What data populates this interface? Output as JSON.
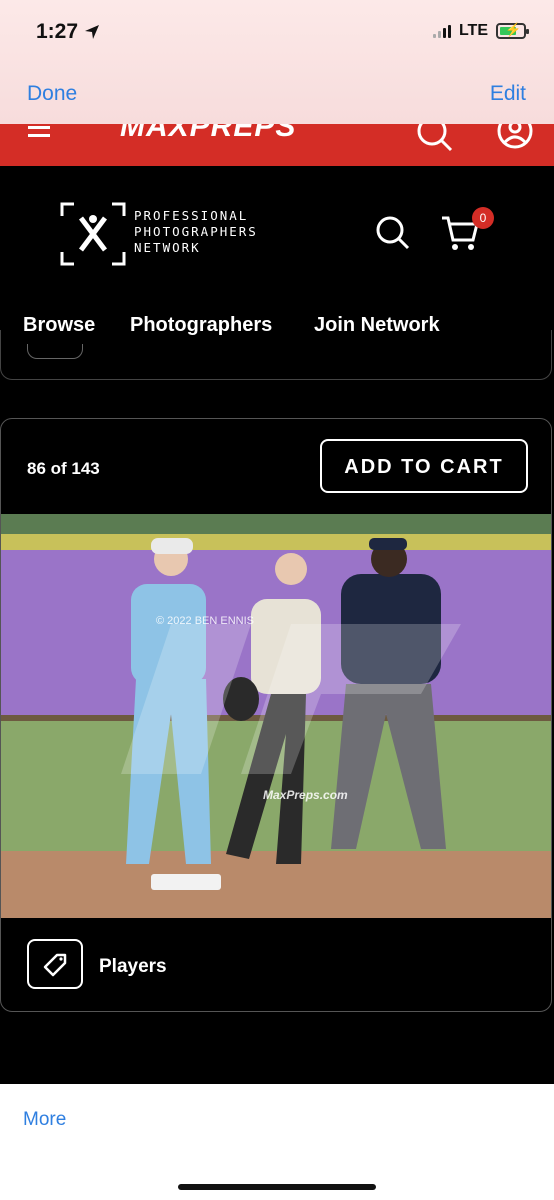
{
  "status_bar": {
    "time": "1:27",
    "network": "LTE"
  },
  "ios_nav": {
    "done_label": "Done",
    "edit_label": "Edit",
    "more_label": "More"
  },
  "maxpreps_bar": {
    "brand": "MAXPREPS",
    "brand_color": "#d42d26"
  },
  "ppn_header": {
    "logo_lines": [
      "PROFESSIONAL",
      "PHOTOGRAPHERS",
      "NETWORK"
    ],
    "cart_count": "0"
  },
  "tabs": [
    "Browse",
    "Photographers",
    "Join Network"
  ],
  "photo_card": {
    "counter": "86 of 143",
    "add_to_cart_label": "ADD TO CART",
    "watermark_credit": "© 2022 BEN ENNIS",
    "watermark_site": "MaxPreps.com",
    "tag_label": "Players"
  },
  "colors": {
    "accent": "#d42d26",
    "ios_blue": "#2f7fe0"
  }
}
